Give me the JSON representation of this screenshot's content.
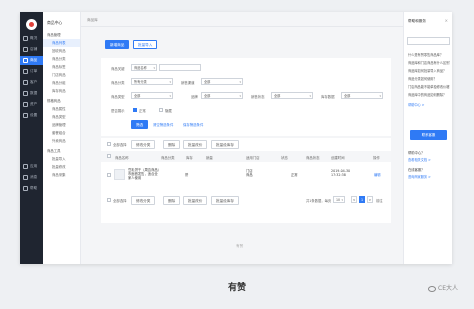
{
  "rail": {
    "items": [
      "概况",
      "店铺",
      "商品",
      "订单",
      "客户",
      "数据",
      "资产",
      "设置"
    ],
    "bottom": [
      "应用",
      "消息",
      "帮助"
    ]
  },
  "subnav": {
    "head": "商品中心",
    "groups": [
      {
        "label": "商品管理",
        "links": [
          "商品列表",
          "回收商品",
          "商品分类",
          "商品标签",
          "门店商品",
          "商品分组",
          "库存商品"
        ]
      },
      {
        "label": "规格商品",
        "links": [
          "商品属性",
          "商品类型",
          "品牌管理",
          "套餐组合",
          "外卖商品"
        ]
      },
      {
        "label": "商品工具",
        "links": [
          "批量导入",
          "批量修改",
          "商品采集"
        ]
      }
    ]
  },
  "main": {
    "breadcrumb": "商品库",
    "add_button": "新增商品",
    "import_button": "批量导入",
    "filters": {
      "keyword_label": "商品关键",
      "keyword_select": "商品名称",
      "category_label": "商品分类",
      "category_value": "所有分类",
      "sales_label": "销售渠道",
      "sales_value": "全部",
      "brand_label": "商品类型",
      "brand_value": "全部",
      "brand2_label": "品牌",
      "brand2_value": "全部",
      "status_label": "销售状态",
      "status_value": "全部",
      "stock_label": "库存数据",
      "stock_value": "全部",
      "show_label": "是否展示",
      "show_options": [
        "正常",
        "隐藏"
      ],
      "search_button": "筛选",
      "clear_link": "清空筛选条件",
      "save_link": "保存筛选条件"
    },
    "table": {
      "toolbar": [
        "全部选择",
        "修改分类",
        "删除",
        "批量改价",
        "批量设库存"
      ],
      "headers": [
        "商品名称",
        "商品分类",
        "库存",
        "销量",
        "适用门店",
        "状态",
        "商品状态",
        "创建时间",
        "操作"
      ],
      "row": {
        "name": "豆乳饼干（周边商品）市面首发售，适合全家人使用",
        "category": "饼",
        "stock": "",
        "sales": "",
        "store": "门店\n商品",
        "status_note": "",
        "state": "正常",
        "time": "2019-04-30\n17:32:38",
        "action": "编辑"
      },
      "bottom_toolbar": [
        "全部选择",
        "修改分类",
        "删除",
        "批量改价",
        "批量设库存"
      ],
      "pager_text": "共1条数据，每页",
      "page_size": "10",
      "pages": [
        "<",
        "1",
        ">"
      ],
      "goto": "前往"
    },
    "footer": "有赞"
  },
  "right_panel": {
    "title": "帮助和服务",
    "search_placeholder": "",
    "faq": [
      "什么是有赞零售商品库？",
      "商品库和门店商品有什么区别？",
      "商品库如何批量导入商品？",
      "商品分类如何使用？",
      "门店商品能不能单独修改价格？",
      "商品库中的商品如何删除？"
    ],
    "more": "帮助中心 >",
    "service_button": "联系客服",
    "q1": "帮助中心？",
    "a1": "查看相关文档 >",
    "q2": "在线客服？",
    "a2": "咨询商家服务 >"
  },
  "caption": "有赞",
  "watermark": "CE大人"
}
